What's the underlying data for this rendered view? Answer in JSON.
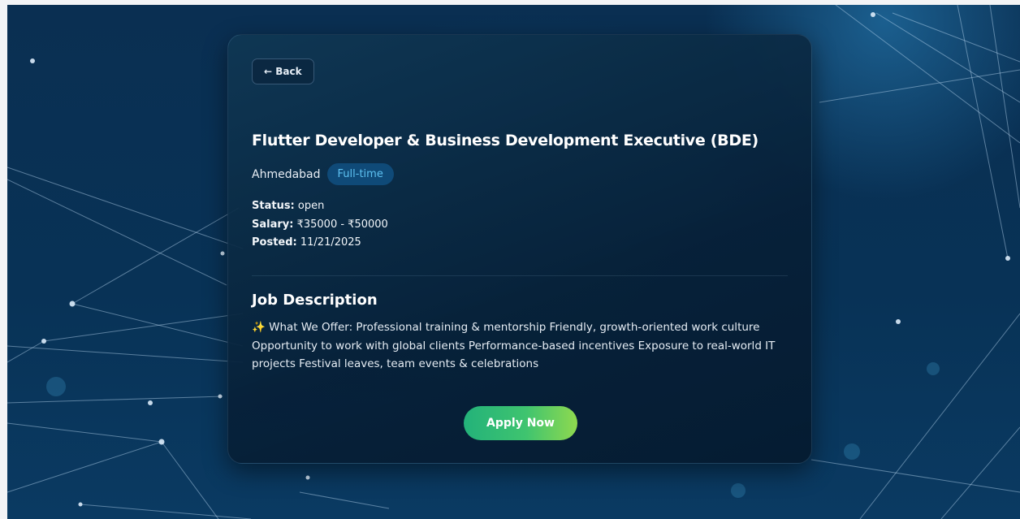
{
  "job": {
    "back_label": "← Back",
    "title": "Flutter Developer & Business Development Executive (BDE)",
    "location": "Ahmedabad",
    "type_badge": "Full-time",
    "status_label": "Status:",
    "status_value": "open",
    "salary_label": "Salary:",
    "salary_value": "₹35000 - ₹50000",
    "posted_label": "Posted:",
    "posted_value": "11/21/2025",
    "description_heading": "Job Description",
    "description_icon": "✨",
    "description_text": "What We Offer: Professional training & mentorship Friendly, growth-oriented work culture Opportunity to work with global clients Performance-based incentives Exposure to real-world IT projects Festival leaves, team events & celebrations",
    "apply_label": "Apply Now"
  },
  "colors": {
    "badge_text": "#5ec2f2",
    "apply_start": "#23b27a",
    "apply_end": "#8fd94f",
    "background": "#0a2f52"
  }
}
